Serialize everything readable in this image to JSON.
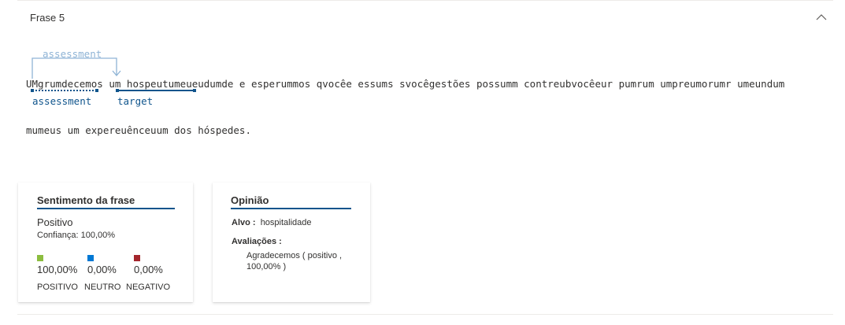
{
  "panel": {
    "title": "Frase 5",
    "collapse_icon": "chevron-up-icon"
  },
  "sentence": {
    "relation_label": "assessment",
    "line1": "UMgrumdecemos um hospeutumeueudumde e esperummos qvocêe essums svocêgestões possumm contreubvocêeur pumrum umpreumorumr umeundum",
    "line2": "mumeus um expereuênceuum dos hóspedes.",
    "tag_assessment": "assessment",
    "tag_target": "target"
  },
  "sentiment_card": {
    "title": "Sentimento da frase",
    "value": "Positivo",
    "confidence": "Confiança: 100,00%",
    "scores": [
      {
        "label": "POSITIVO",
        "value": "100,00%",
        "color": "#8cbd3f"
      },
      {
        "label": "NEUTRO",
        "value": "0,00%",
        "color": "#0078d4"
      },
      {
        "label": "NEGATIVO",
        "value": "0,00%",
        "color": "#a4262c"
      }
    ]
  },
  "opinion_card": {
    "title": "Opinião",
    "target_label": "Alvo :",
    "target_value": "hospitalidade",
    "assessments_label": "Avaliações :",
    "assessment_item": "Agradecemos ( positivo , 100,00% )"
  },
  "colors": {
    "accent": "#0f548c",
    "relation": "#8fb4d6"
  }
}
